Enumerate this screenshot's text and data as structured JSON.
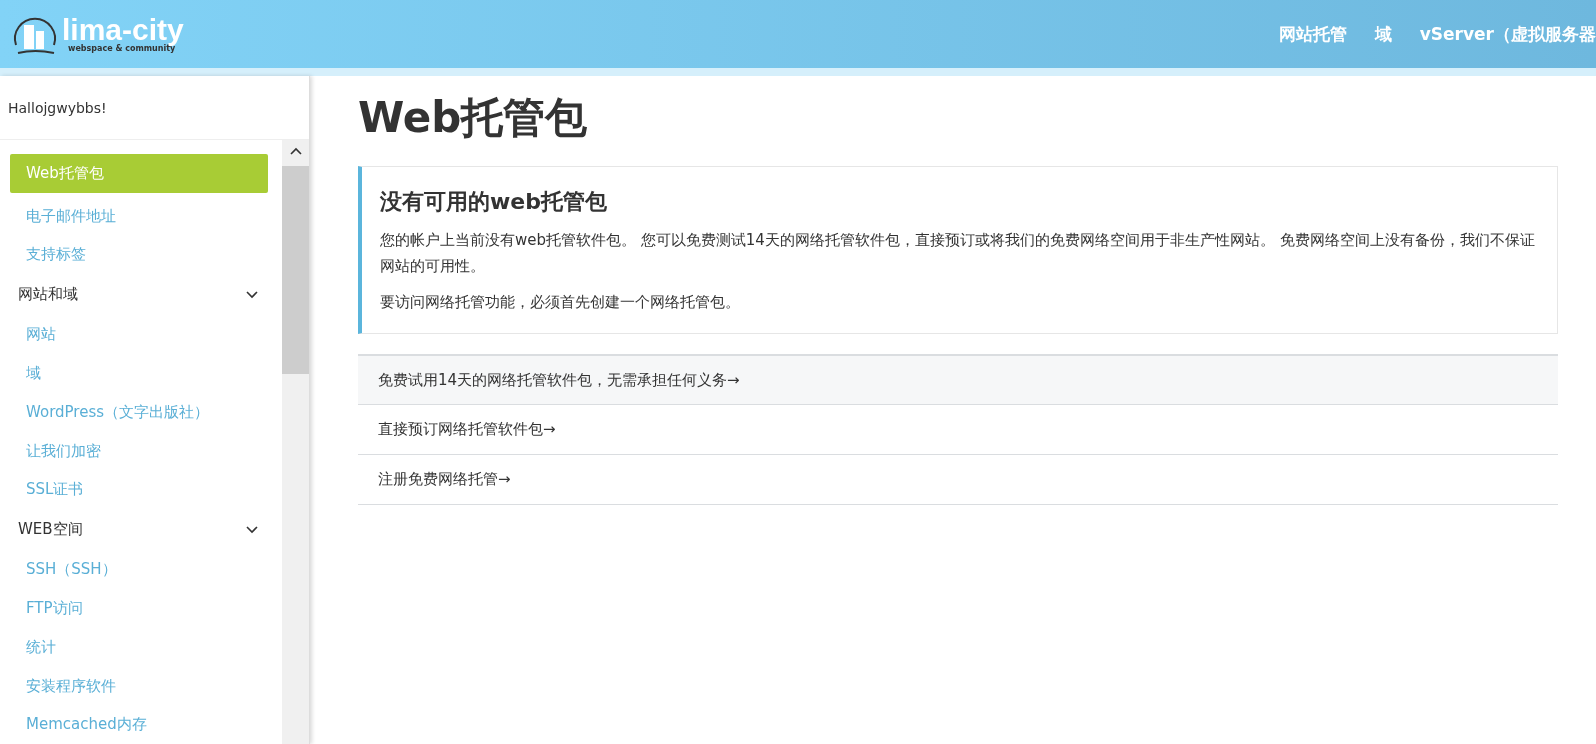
{
  "header": {
    "logo": {
      "name": "lima-city",
      "tagline": "webspace & community"
    },
    "nav": [
      "网站托管",
      "域",
      "vServer（虚拟服务器"
    ]
  },
  "sidebar": {
    "greeting": "Hallojgwybbs!",
    "items": [
      {
        "kind": "link",
        "label": "Web托管包",
        "selected": true
      },
      {
        "kind": "link",
        "label": "电子邮件地址",
        "selected": false
      },
      {
        "kind": "link",
        "label": "支持标签",
        "selected": false
      },
      {
        "kind": "section",
        "label": "网站和域",
        "expanded": true
      },
      {
        "kind": "link",
        "label": "网站",
        "selected": false
      },
      {
        "kind": "link",
        "label": "域",
        "selected": false
      },
      {
        "kind": "link",
        "label": "WordPress（文字出版社）",
        "selected": false
      },
      {
        "kind": "link",
        "label": "让我们加密",
        "selected": false
      },
      {
        "kind": "link",
        "label": "SSL证书",
        "selected": false
      },
      {
        "kind": "section",
        "label": "WEB空间",
        "expanded": true
      },
      {
        "kind": "link",
        "label": "SSH（SSH）",
        "selected": false
      },
      {
        "kind": "link",
        "label": "FTP访问",
        "selected": false
      },
      {
        "kind": "link",
        "label": "统计",
        "selected": false
      },
      {
        "kind": "link",
        "label": "安装程序软件",
        "selected": false
      },
      {
        "kind": "link",
        "label": "Memcached内存",
        "selected": false
      }
    ]
  },
  "main": {
    "title": "Web托管包",
    "notice": {
      "title": "没有可用的web托管包",
      "paragraphs": [
        "您的帐户上当前没有web托管软件包。 您可以免费测试14天的网络托管软件包，直接预订或将我们的免费网络空间用于非生产性网站。 免费网络空间上没有备份，我们不保证网站的可用性。",
        "要访问网络托管功能，必须首先创建一个网络托管包。"
      ]
    },
    "actions": [
      {
        "label": "免费试用14天的网络托管软件包，无需承担任何义务→",
        "selected": true
      },
      {
        "label": "直接预订网络托管软件包→",
        "selected": false
      },
      {
        "label": "注册免费网络托管→",
        "selected": false
      }
    ]
  }
}
